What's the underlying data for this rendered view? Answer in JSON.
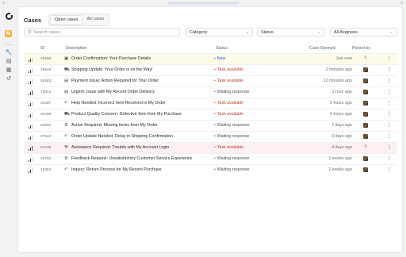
{
  "app": {
    "title": "Cases",
    "tabs": [
      {
        "label": "Open cases",
        "active": true
      },
      {
        "label": "All cases",
        "active": false
      }
    ]
  },
  "rail": {
    "logo": "app-logo",
    "active_badge": "M",
    "icons": [
      "wrench-icon",
      "inbox-icon",
      "grid-icon",
      "history-icon"
    ]
  },
  "filters": {
    "search_placeholder": "Search cases",
    "category": "Category",
    "status": "Status",
    "assignee": "All Asignees"
  },
  "table": {
    "headers": {
      "id": "ID",
      "description": "Description",
      "status": "Status",
      "opened": "Case Opened",
      "picked": "Picked by"
    },
    "rows": [
      {
        "priority": 2,
        "id": "48285",
        "icon": "box-icon",
        "description": "Order Confirmation: Your Purchase Details",
        "status": "New",
        "status_type": "new",
        "opened": "Just now",
        "picked": "user",
        "highlight": "yellow"
      },
      {
        "priority": 2,
        "id": "18549",
        "icon": "truck-icon",
        "description": "Shipping Update: Your Order is on the Way!",
        "status": "Task available",
        "status_type": "task",
        "opened": "2 minutes ago",
        "picked": "avatar",
        "highlight": ""
      },
      {
        "priority": 2,
        "id": "46283",
        "icon": "document-icon",
        "description": "Payment Issue: Action Required for Your Order",
        "status": "Task available",
        "status_type": "task",
        "opened": "12 minutes ago",
        "picked": "avatar",
        "highlight": ""
      },
      {
        "priority": 3,
        "id": "75814",
        "icon": "document-icon",
        "description": "Urgent: Issue with My Recent Order Delivery",
        "status": "Waiting response",
        "status_type": "wait",
        "opened": "1 hour ago",
        "picked": "avatar",
        "highlight": ""
      },
      {
        "priority": 2,
        "id": "31687",
        "icon": "reply-icon",
        "description": "Help Needed: Incorrect Item Received in My Order",
        "status": "Task available",
        "status_type": "task",
        "opened": "5 hours ago",
        "picked": "avatar",
        "highlight": ""
      },
      {
        "priority": 2,
        "id": "20495",
        "icon": "truck-icon",
        "description": "Product Quality Concern: Defective Item from My Purchase",
        "status": "Task available",
        "status_type": "task",
        "opened": "6 hours ago",
        "picked": "avatar",
        "highlight": ""
      },
      {
        "priority": 2,
        "id": "63831",
        "icon": "settings-icon",
        "description": "Action Required: Missing Items from My Order",
        "status": "Waiting response",
        "status_type": "wait",
        "opened": "2 days ago",
        "picked": "avatar",
        "highlight": ""
      },
      {
        "priority": 2,
        "id": "97542",
        "icon": "reply-icon",
        "description": "Order Update Needed: Delay in Shipping Confirmation",
        "status": "Waiting response",
        "status_type": "wait",
        "opened": "3 days ago",
        "picked": "avatar",
        "highlight": ""
      },
      {
        "priority": 3,
        "id": "81239",
        "icon": "wrench-icon",
        "description": "Assistance Required: Trouble with My Account Login",
        "status": "Task available",
        "status_type": "task",
        "opened": "4 days ago",
        "picked": "user",
        "highlight": "red"
      },
      {
        "priority": 2,
        "id": "45780",
        "icon": "settings-icon",
        "description": "Feedback Request: Unsatisfactory Customer Service Experience",
        "status": "Waiting response",
        "status_type": "wait",
        "opened": "2 weeks ago",
        "picked": "avatar",
        "highlight": ""
      },
      {
        "priority": 2,
        "id": "18364",
        "icon": "reply-icon",
        "description": "Inquiry: Return Process for My Recent Purchase",
        "status": "Waiting response",
        "status_type": "wait",
        "opened": "2 weeks ago",
        "picked": "avatar",
        "highlight": ""
      }
    ]
  },
  "colors": {
    "accent": "#f6b54b",
    "status_new": "#2f5fd0",
    "status_task": "#c23a2a",
    "row_highlight_yellow": "#fffbe9",
    "row_highlight_red": "#fdf0f1"
  }
}
